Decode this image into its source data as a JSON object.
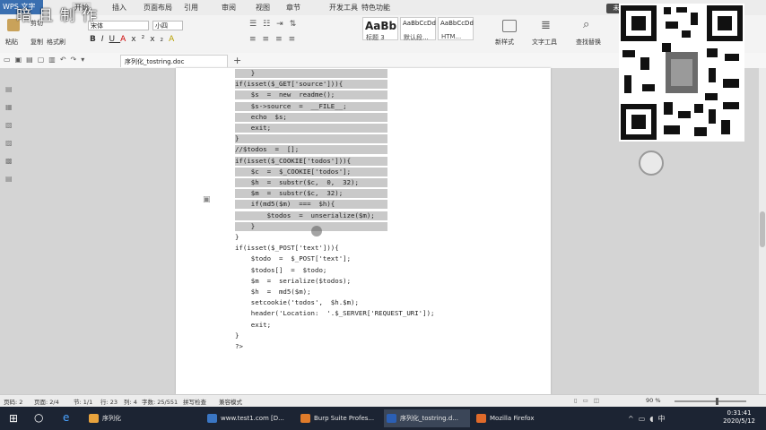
{
  "app": {
    "badge": "WPS 文字",
    "watermark": "暗 且 制 作",
    "login": "未登录"
  },
  "menu_tabs": [
    "开始",
    "插入",
    "页面布局",
    "引用",
    "审阅",
    "视图",
    "章节",
    "开发工具",
    "特色功能"
  ],
  "ribbon": {
    "paste": "粘贴",
    "cut": "剪切",
    "copy": "复制",
    "format_painter": "格式刷",
    "font_name": "宋体",
    "font_size": "小四",
    "styles": [
      {
        "sample": "AaBb",
        "name": "标题 3"
      },
      {
        "sample": "AaBbCcDd",
        "name": "默认段..."
      },
      {
        "sample": "AaBbCcDd",
        "name": "HTM..."
      }
    ],
    "new_style": "新样式",
    "text_tools": "文字工具",
    "find_replace": "查找替换"
  },
  "document": {
    "tab_title": "序列化_tostring.doc",
    "code_lines": [
      "    }",
      "if(isset($_GET['source'])){",
      "    $s  =  new  readme();",
      "    $s->source  =  __FILE__;",
      "    echo  $s;",
      "    exit;",
      "}",
      "//$todos  =  [];",
      "if(isset($_COOKIE['todos'])){",
      "    $c  =  $_COOKIE['todos'];",
      "    $h  =  substr($c,  0,  32);",
      "    $m  =  substr($c,  32);",
      "    if(md5($m)  ===  $h){",
      "        $todos  =  unserialize($m);",
      "    }",
      "}",
      "if(isset($_POST['text'])){",
      "    $todo  =  $_POST['text'];",
      "    $todos[]  =  $todo;",
      "    $m  =  serialize($todos);",
      "    $h  =  md5($m);",
      "    setcookie('todos',  $h.$m);",
      "    header('Location:  '.$_SERVER['REQUEST_URI']);",
      "    exit;",
      "}",
      "?>"
    ]
  },
  "status": {
    "page": "页码: 2",
    "pages": "页面: 2/4",
    "section": "节: 1/1",
    "row": "行: 23",
    "col": "列: 4",
    "words": "字数: 25/551",
    "spell": "拼写检查",
    "mode": "兼容模式",
    "zoom": "90 %"
  },
  "taskbar": {
    "items": [
      "序列化",
      "www.test1.com [D...",
      "Burp Suite Profes...",
      "序列化_tostring.d...",
      "Mozilla Firefox"
    ],
    "time": "0:31:41",
    "date": "2020/5/12"
  }
}
